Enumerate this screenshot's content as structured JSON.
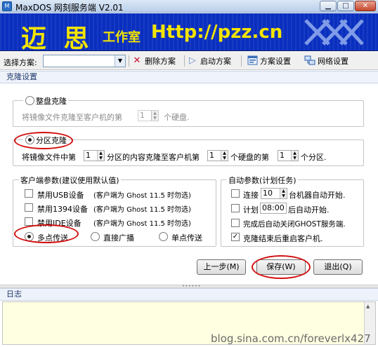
{
  "window": {
    "title": "MaxDOS 网刻服务端 V2.01",
    "icon_text": "M"
  },
  "banner": {
    "logo_text": "迈 思",
    "studio_text": "工作室",
    "url_text": "Http://pzz.cn"
  },
  "toolbar": {
    "scheme_label": "选择方案:",
    "scheme_value": "",
    "delete_label": "删除方案",
    "start_label": "启动方案",
    "scheme_settings_label": "方案设置",
    "network_settings_label": "网络设置"
  },
  "clone_section": {
    "header": "克隆设置",
    "whole_disk": {
      "label": "整盘克隆",
      "selected": false,
      "desc_prefix": "将镜像文件克隆至客户机的第",
      "disk_value": "1",
      "desc_suffix": "个硬盘."
    },
    "partition": {
      "label": "分区克隆",
      "selected": true,
      "p1": "将镜像文件中第",
      "v1": "1",
      "p2": "分区的内容克隆至客户机第",
      "v2": "1",
      "p3": "个硬盘的第",
      "v3": "1",
      "p4": "个分区."
    }
  },
  "client_params": {
    "title": "客户端参数(建议使用默认值)",
    "options": [
      {
        "label": "禁用USB设备",
        "note": "(客户端为 Ghost 11.5 时勿选)",
        "checked": false
      },
      {
        "label": "禁用1394设备",
        "note": "(客户端为 Ghost 11.5 时勿选)",
        "checked": false
      },
      {
        "label": "禁用IDE设备",
        "note": "(客户端为 Ghost 11.5 时勿选)",
        "checked": false
      }
    ],
    "modes": [
      {
        "label": "多点传送",
        "selected": true
      },
      {
        "label": "直接广播",
        "selected": false
      },
      {
        "label": "单点传送",
        "selected": false
      }
    ]
  },
  "auto_params": {
    "title": "自动参数(计划任务)",
    "connect_prefix": "连接",
    "connect_value": "10",
    "connect_suffix": "台机器自动开始.",
    "plan_prefix": "计划",
    "plan_time": "08:00",
    "plan_suffix": "后自动开始.",
    "close_ghost_label": "完成后自动关闭GHOST服务端.",
    "restart_label": "克隆结束后重启客户机.",
    "connect_checked": false,
    "plan_checked": false,
    "close_ghost_checked": false,
    "restart_checked": true
  },
  "buttons": {
    "prev": "上一步(M)",
    "save": "保存(W)",
    "exit": "退出(Q)"
  },
  "log": {
    "header": "日志"
  },
  "watermark": "blog.sina.com.cn/foreverlx427",
  "colors": {
    "accent": "#0a2fbf",
    "logo_yellow": "#f4e400",
    "highlight_ring": "#d20f0f",
    "log_bg": "#ffffe1"
  },
  "icons": {
    "delete": "x-icon",
    "start": "play-icon",
    "scheme_settings": "window-settings-icon",
    "network_settings": "network-icon"
  }
}
